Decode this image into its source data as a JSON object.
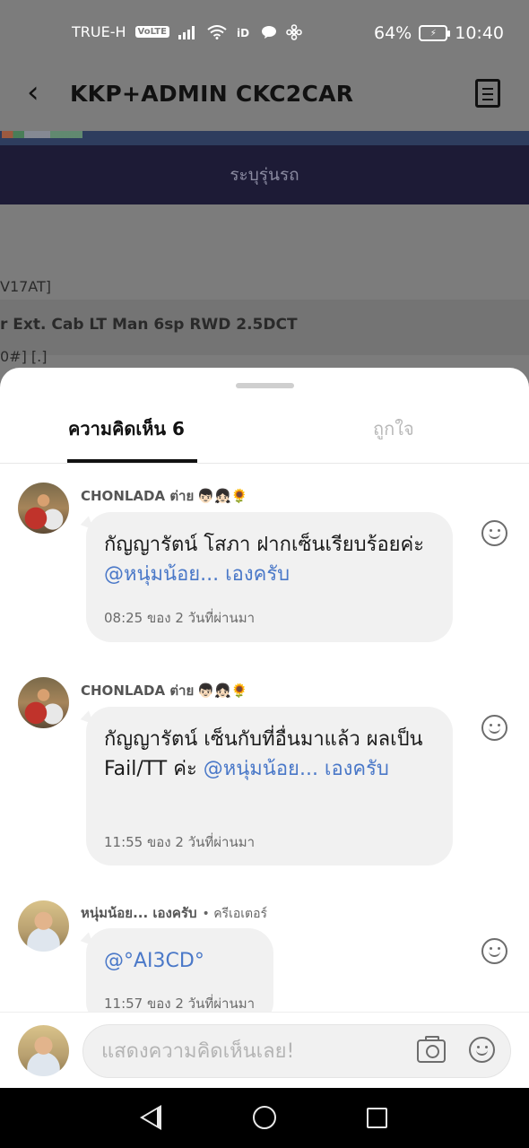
{
  "status_bar": {
    "carrier": "TRUE-H",
    "volte": "VoLTE",
    "battery": "64%",
    "time": "10:40"
  },
  "app_bar": {
    "title": "KKP+ADMIN CKC2CAR"
  },
  "background_page": {
    "banner_text": "ระบุรุ่นรถ",
    "row1": "V17AT]",
    "row2": "r Ext. Cab LT Man 6sp RWD 2.5DCT",
    "row3": "0#] [.]"
  },
  "sheet": {
    "tabs": {
      "comments": "ความคิดเห็น 6",
      "likes": "ถูกใจ"
    },
    "comments": [
      {
        "author": "CHONLADA ต่าย",
        "emoji": "👦🏻👧🏻🌻",
        "text": "กัญญารัตน์ โสภา ฝากเซ็นเรียบร้อยค่ะ ",
        "mention": "@หนุ่มน้อย... เองครับ",
        "time": "08:25 ของ 2 วันที่ผ่านมา"
      },
      {
        "author": "CHONLADA ต่าย",
        "emoji": "👦🏻👧🏻🌻",
        "text": "กัญญารัตน์ เซ็นกับที่อื่นมาแล้ว ผลเป็น Fail/TT ค่ะ ",
        "mention": "@หนุ่มน้อย... เองครับ",
        "time": "11:55 ของ 2 วันที่ผ่านมา"
      },
      {
        "author": "หนุ่มน้อย... เองครับ",
        "role": "• ครีเอเตอร์",
        "mention": "@°AI3CD°",
        "time": "11:57 ของ 2 วันที่ผ่านมา"
      }
    ]
  },
  "input": {
    "placeholder": "แสดงความคิดเห็นเลย!"
  },
  "icons": {
    "back": "back-arrow-icon",
    "menu": "document-menu-icon",
    "react": "smiley-icon",
    "camera": "camera-icon",
    "emoji": "emoji-icon"
  },
  "colors": {
    "mention": "#4a78c8",
    "banner": "#1d1b36",
    "overlay": "#7c7c7c"
  }
}
